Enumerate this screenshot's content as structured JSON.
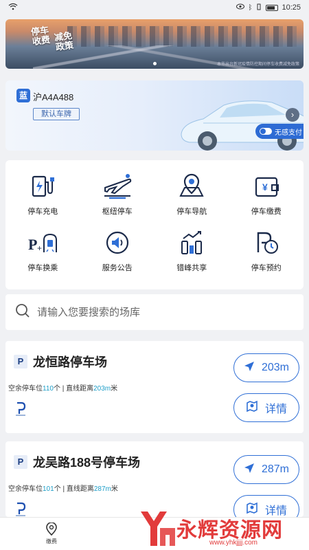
{
  "status": {
    "time": "10:25"
  },
  "banner": {
    "title_line1": "停车收费",
    "title_line2": "减免政策",
    "caption": "本市出台新冠疫情防控期间停车收费减免政策"
  },
  "plate": {
    "badge": "蓝",
    "number": "沪A4A488",
    "default_label": "默认车牌",
    "nosense_label": "无感支付"
  },
  "services": [
    {
      "label": "停车充电",
      "icon": "ev-charger-icon"
    },
    {
      "label": "枢纽停车",
      "icon": "plane-parking-icon"
    },
    {
      "label": "停车导航",
      "icon": "map-pin-icon"
    },
    {
      "label": "停车缴费",
      "icon": "wallet-icon"
    },
    {
      "label": "停车换乘",
      "icon": "park-and-ride-icon"
    },
    {
      "label": "服务公告",
      "icon": "speaker-icon"
    },
    {
      "label": "错峰共享",
      "icon": "shared-parking-icon"
    },
    {
      "label": "停车预约",
      "icon": "reservation-clock-icon"
    }
  ],
  "search": {
    "placeholder": "请输入您要搜索的场库"
  },
  "lots": [
    {
      "name": "龙恒路停车场",
      "info_prefix": "空余停车位",
      "free_spaces": "110",
      "info_mid": "个 | 直线距离",
      "distance": "203m",
      "info_suffix": "米",
      "nav_label": "203m",
      "detail_label": "详情"
    },
    {
      "name": "龙吴路188号停车场",
      "info_prefix": "空余停车位",
      "free_spaces": "101",
      "info_mid": "个 | 直线距离",
      "distance": "287m",
      "info_suffix": "米",
      "nav_label": "287m",
      "detail_label": "详情"
    }
  ],
  "bottom_nav": {
    "tab1_label": "缴费"
  },
  "watermark": {
    "text": "永辉资源网",
    "sub": "www.yhkjjjj.com"
  },
  "colors": {
    "accent": "#2f6fd6",
    "highlight": "#1e9ec8"
  }
}
